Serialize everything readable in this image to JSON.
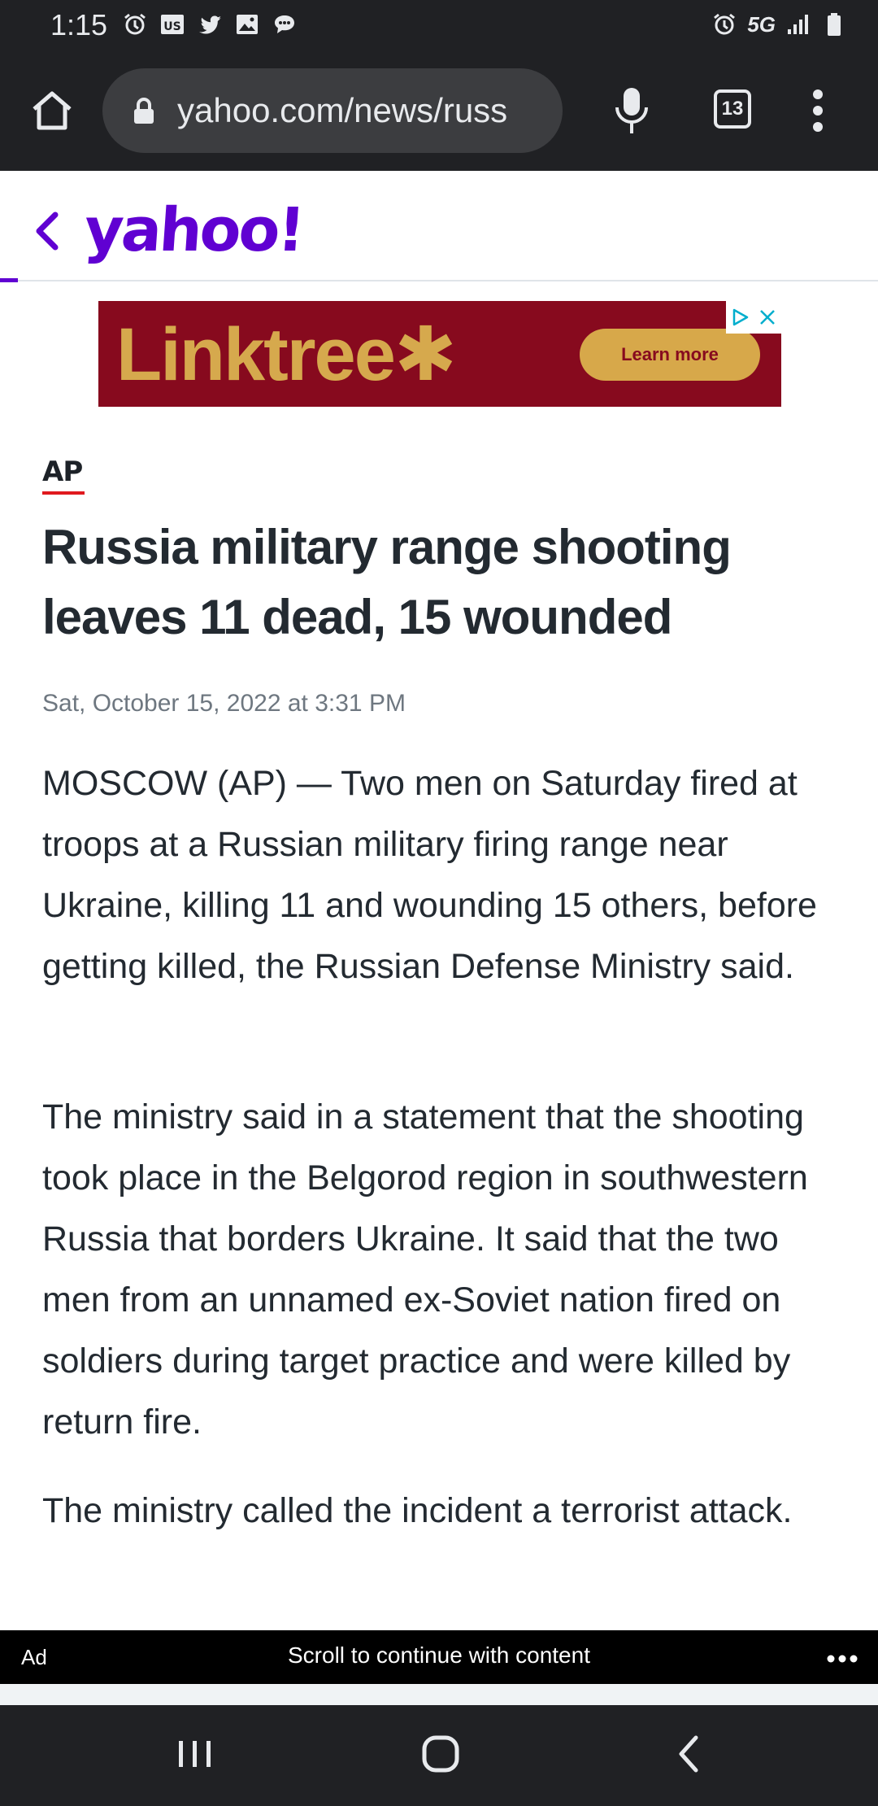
{
  "status_bar": {
    "time": "1:15",
    "left_icons": [
      "alarm-icon",
      "us-news-icon",
      "twitter-icon",
      "gallery-icon",
      "chat-icon"
    ],
    "right_icons": [
      "alarm-icon",
      "signal-icon",
      "battery-icon"
    ],
    "network": "5G"
  },
  "browser": {
    "url": "yahoo.com/news/russ",
    "tab_count": "13",
    "icons": [
      "home-icon",
      "lock-icon",
      "mic-icon",
      "tabs-icon",
      "more-vert-icon"
    ]
  },
  "site_header": {
    "logo": "yahoo!",
    "accent_color": "#6001d2"
  },
  "top_ad": {
    "brand": "Linktree✱",
    "cta": "Learn more",
    "bg_color": "#870a1e",
    "accent_color": "#d6a94d"
  },
  "article": {
    "source": "AP",
    "headline": "Russia military range shooting leaves 11 dead, 15 wounded",
    "date": "Sat, October 15, 2022 at 3:31 PM",
    "paragraphs": [
      "MOSCOW (AP) — Two men on Saturday fired at troops at a Russian military firing range near Ukraine, killing 11 and wounding 15 others, before getting killed, the Russian Defense Ministry said.",
      "The ministry said in a statement that the shooting took place in the Belgorod region in southwestern Russia that borders Ukraine. It said that the two men from an unnamed ex-Soviet nation fired on soldiers during target practice and were killed by return fire.",
      "The ministry called the incident a terrorist attack."
    ]
  },
  "scroll_prompt": {
    "ad_label": "Ad",
    "text": "Scroll to continue with content",
    "more": "•••"
  },
  "nav_bar": {
    "buttons": [
      "recent-apps-icon",
      "home-icon",
      "back-icon"
    ]
  }
}
